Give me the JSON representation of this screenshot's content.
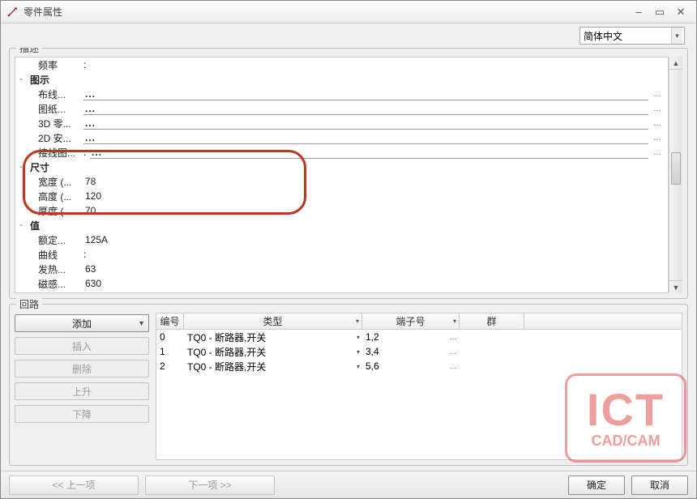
{
  "title": "零件属性",
  "language": {
    "selected": "简体中文"
  },
  "desc": {
    "legend": "描述",
    "rows": [
      {
        "indent": 1,
        "label": "频率",
        "colon": ":",
        "value": "",
        "type": "text"
      },
      {
        "indent": 0,
        "expand": "-",
        "label": "图示",
        "bold": true
      },
      {
        "indent": 1,
        "label": "布线...",
        "type": "input",
        "dots": "..."
      },
      {
        "indent": 1,
        "label": "图纸...",
        "type": "input",
        "dots": "..."
      },
      {
        "indent": 1,
        "label": "3D 零...",
        "type": "input",
        "dots": "..."
      },
      {
        "indent": 1,
        "label": "2D 安...",
        "type": "input",
        "dots": "..."
      },
      {
        "indent": 1,
        "label": "接线图...",
        "colon": ":",
        "type": "input",
        "dots": "..."
      },
      {
        "indent": 0,
        "expand": "-",
        "label": "尺寸",
        "bold": true
      },
      {
        "indent": 1,
        "label": "宽度 (...",
        "value": "78"
      },
      {
        "indent": 1,
        "label": "高度 (...",
        "value": "120"
      },
      {
        "indent": 1,
        "label": "厚度 (...",
        "value": "70"
      },
      {
        "indent": 0,
        "expand": "-",
        "label": "值",
        "bold": true
      },
      {
        "indent": 1,
        "label": "额定...",
        "value": "125A"
      },
      {
        "indent": 1,
        "label": "曲线",
        "colon": ":",
        "value": ""
      },
      {
        "indent": 1,
        "label": "发热...",
        "value": "63"
      },
      {
        "indent": 1,
        "label": "磁感...",
        "value": "630"
      }
    ]
  },
  "circuits": {
    "legend": "回路",
    "buttons": {
      "add": "添加",
      "insert": "插入",
      "delete": "删除",
      "up": "上升",
      "down": "下降"
    },
    "columns": {
      "num": "编号",
      "type": "类型",
      "term": "端子号",
      "group": "群"
    },
    "rows": [
      {
        "num": "0",
        "type": "TQ0 - 断路器,开关",
        "term": "1,2",
        "group": ""
      },
      {
        "num": "1",
        "type": "TQ0 - 断路器,开关",
        "term": "3,4",
        "group": ""
      },
      {
        "num": "2",
        "type": "TQ0 - 断路器,开关",
        "term": "5,6",
        "group": ""
      }
    ]
  },
  "footer": {
    "prev": "<< 上一项",
    "next": "下一项 >>",
    "ok": "确定",
    "cancel": "取消"
  },
  "watermark": {
    "big": "ICT",
    "small": "CAD/CAM"
  }
}
